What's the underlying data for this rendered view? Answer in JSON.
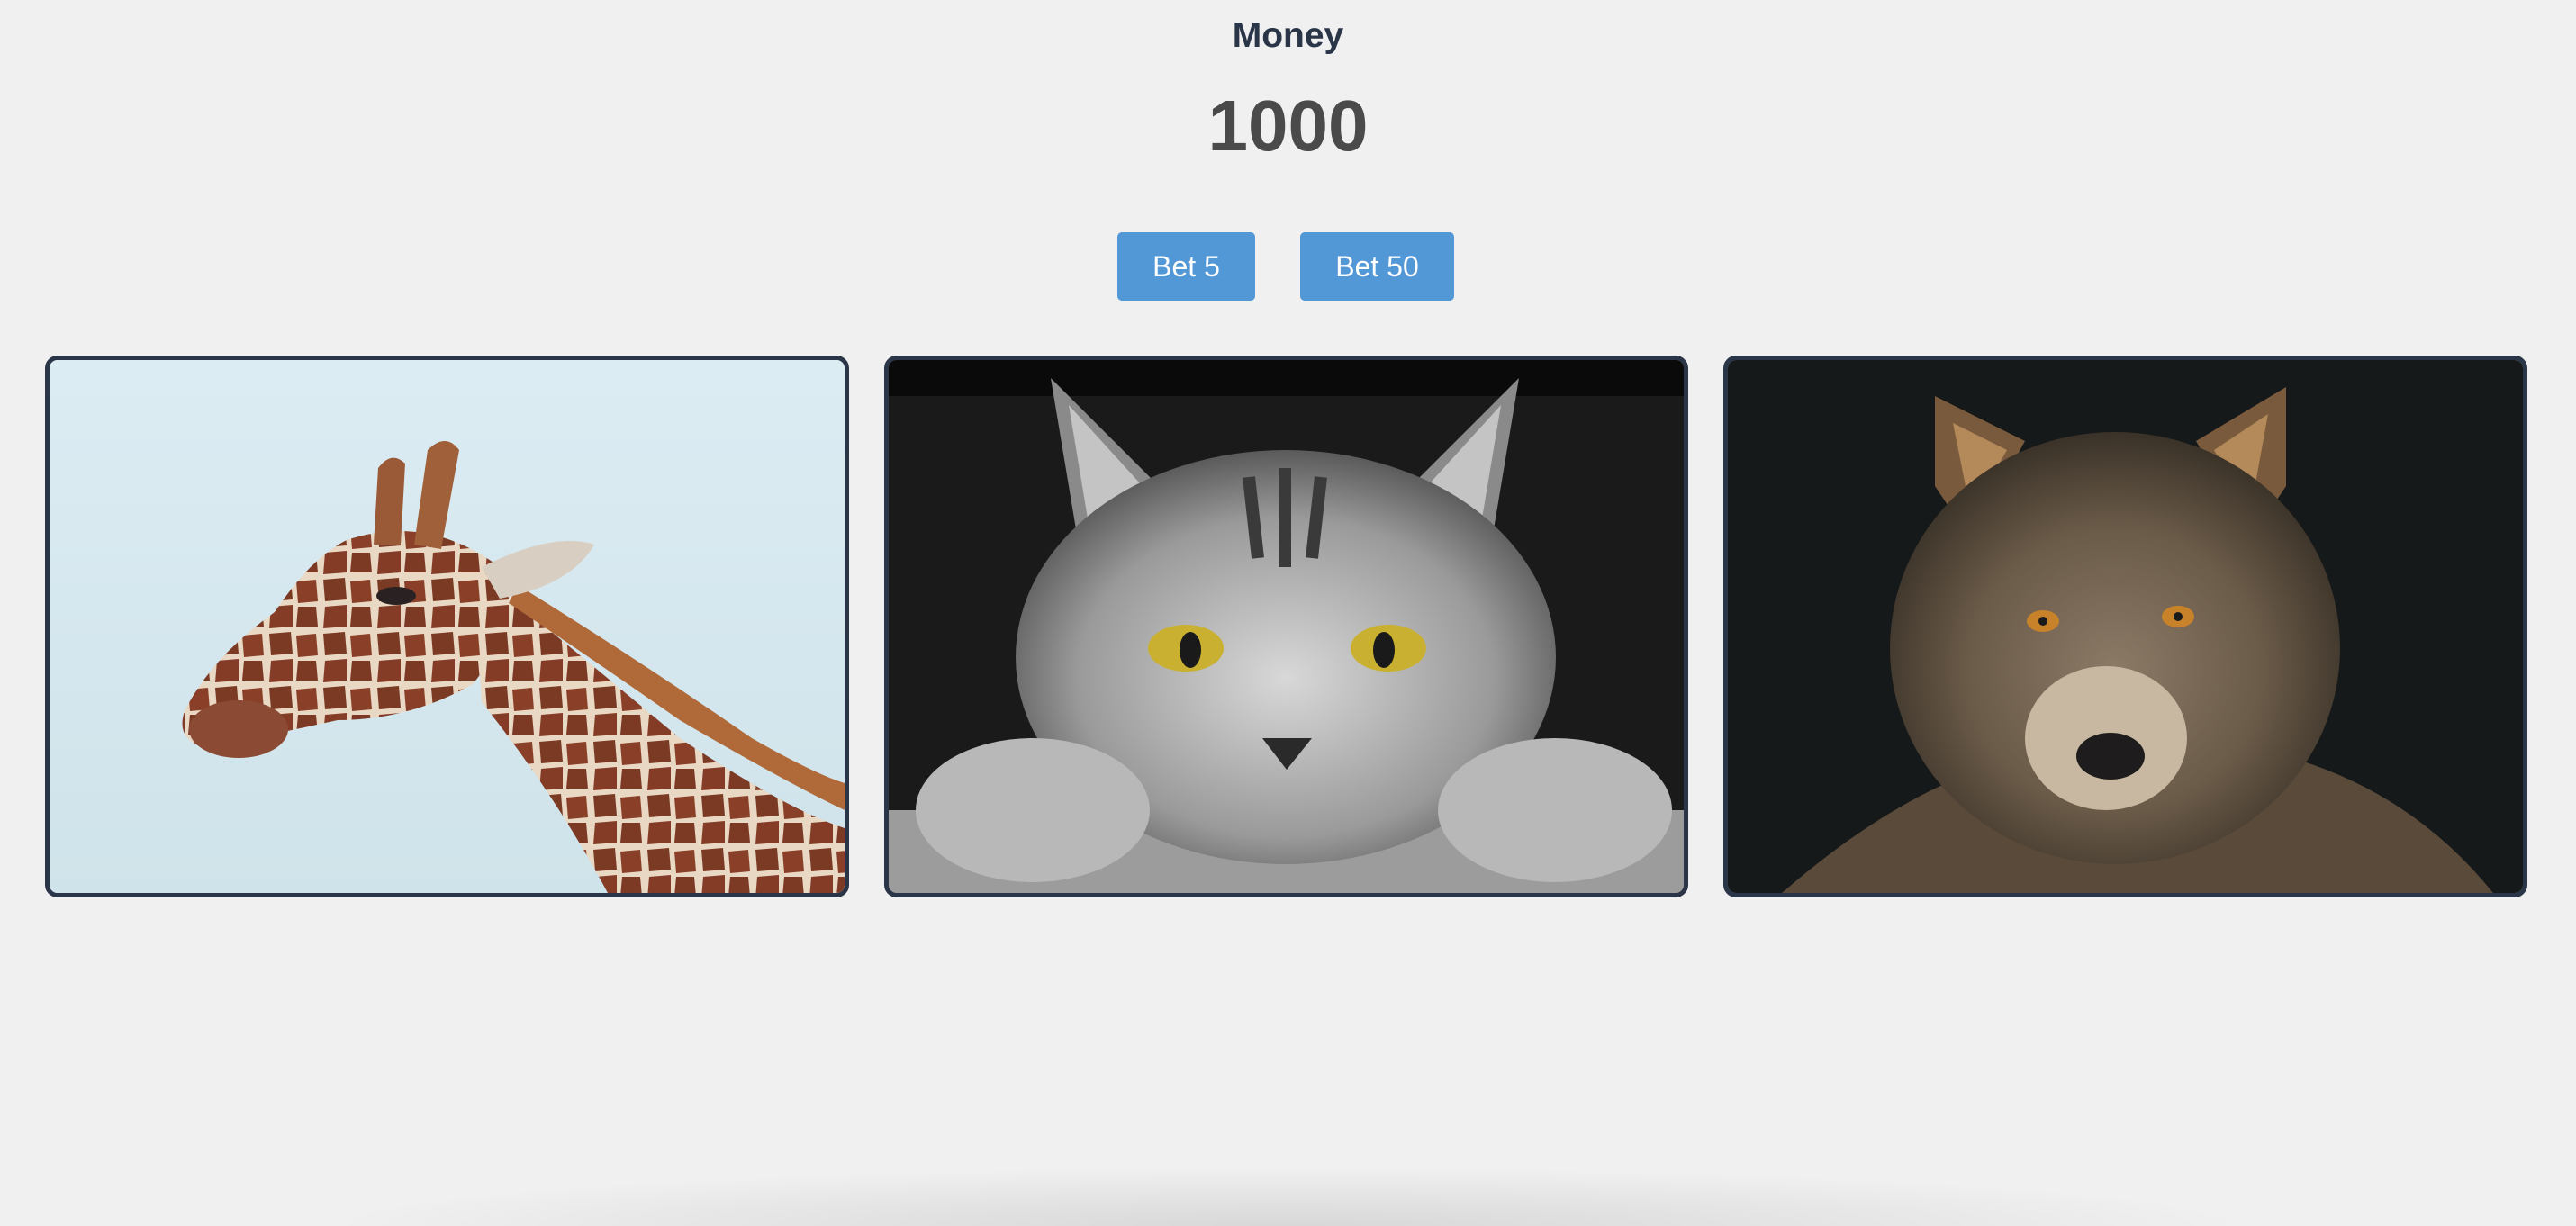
{
  "header": {
    "money_label": "Money",
    "money_value": "1000"
  },
  "buttons": {
    "bet_5_label": "Bet 5",
    "bet_50_label": "Bet 50"
  },
  "cards": [
    {
      "image": "giraffe-photo"
    },
    {
      "image": "cat-photo"
    },
    {
      "image": "wolf-photo"
    }
  ],
  "colors": {
    "background": "#f0f0f0",
    "heading": "#2a3548",
    "money": "#4a4a4a",
    "button": "#5297d6",
    "card_border": "#2a3548"
  }
}
